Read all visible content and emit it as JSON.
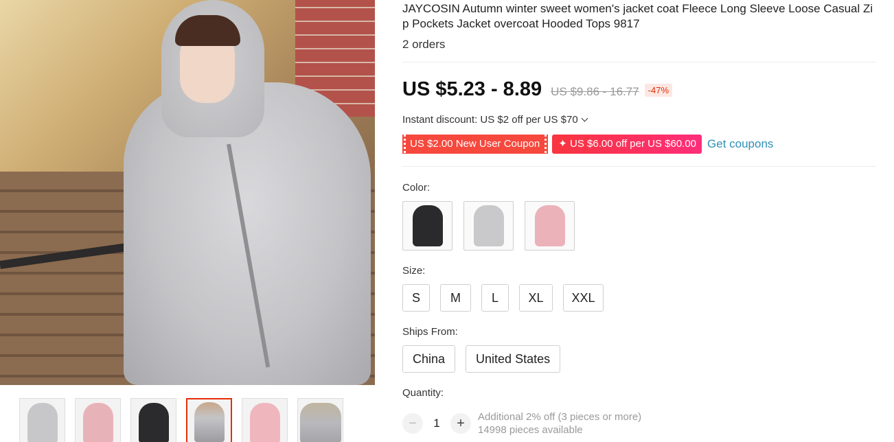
{
  "product": {
    "title": "JAYCOSIN Autumn winter sweet women's jacket coat Fleece Long Sleeve Loose Casual Zip Pockets Jacket overcoat Hooded Tops 9817",
    "orders": "2 orders"
  },
  "price": {
    "current": "US $5.23 - 8.89",
    "original": "US $9.86 - 16.77",
    "discount": "-47%"
  },
  "instant_discount": "Instant discount: US $2 off per US $70",
  "coupons": {
    "new_user": "US $2.00 New User Coupon",
    "store": "✦ US $6.00 off per US $60.00",
    "get_link": "Get coupons"
  },
  "color": {
    "label": "Color:",
    "options": [
      "black-hoodie",
      "gray-hoodie",
      "pink-hoodie"
    ]
  },
  "size": {
    "label": "Size:",
    "options": [
      "S",
      "M",
      "L",
      "XL",
      "XXL"
    ]
  },
  "ships_from": {
    "label": "Ships From:",
    "options": [
      "China",
      "United States"
    ]
  },
  "quantity": {
    "label": "Quantity:",
    "value": "1",
    "minus": "−",
    "plus": "+",
    "note_discount": "Additional 2% off (3 pieces or more)",
    "note_available": "14998 pieces available"
  },
  "gallery": {
    "thumbnails": [
      "gray-hoodie",
      "pink-hoodie",
      "black-hoodie",
      "gray-hoodie-bench",
      "pink-fleece",
      "gray-hoodie-closeup"
    ],
    "active_index": 3
  },
  "colors": {
    "accent": "#e62e04",
    "link": "#2e8fb7",
    "coupon_red": "#f6483d",
    "coupon_pink": "#ff2d7a"
  }
}
